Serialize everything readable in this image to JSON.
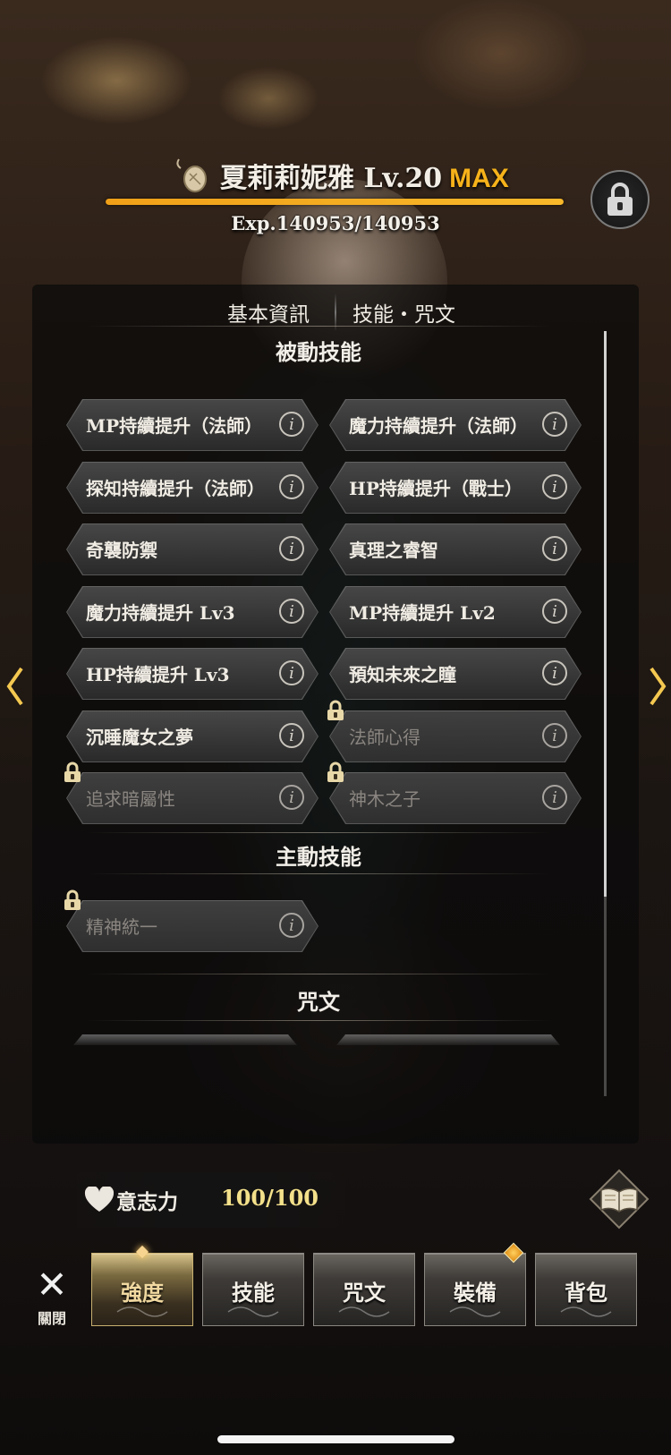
{
  "character": {
    "name": "夏莉莉妮雅",
    "level": "Lv.20",
    "max_label": "MAX",
    "exp": "Exp.140953/140953",
    "exp_progress": 1.0
  },
  "tabs": {
    "basic": "基本資訊",
    "skill": "技能・咒文",
    "active": "skill"
  },
  "sections": {
    "passive": "被動技能",
    "active": "主動技能",
    "spells": "咒文"
  },
  "passive_skills": [
    {
      "label": "MP持續提升（法師）",
      "locked": false
    },
    {
      "label": "魔力持續提升（法師）",
      "locked": false
    },
    {
      "label": "探知持續提升（法師）",
      "locked": false
    },
    {
      "label": "HP持續提升（戰士）",
      "locked": false
    },
    {
      "label": "奇襲防禦",
      "locked": false
    },
    {
      "label": "真理之睿智",
      "locked": false
    },
    {
      "label": "魔力持續提升 Lv3",
      "locked": false
    },
    {
      "label": "MP持續提升 Lv2",
      "locked": false
    },
    {
      "label": "HP持續提升 Lv3",
      "locked": false
    },
    {
      "label": "預知未來之瞳",
      "locked": false
    },
    {
      "label": "沉睡魔女之夢",
      "locked": false
    },
    {
      "label": "法師心得",
      "locked": true
    },
    {
      "label": "追求暗屬性",
      "locked": true
    },
    {
      "label": "神木之子",
      "locked": true
    }
  ],
  "active_skills": [
    {
      "label": "精神統一",
      "locked": true
    }
  ],
  "info_glyph": "i",
  "will": {
    "label": "意志力",
    "value": "100/100"
  },
  "bottom_nav": {
    "close_label": "關閉",
    "items": [
      {
        "label": "強度",
        "active": true,
        "badge": false
      },
      {
        "label": "技能",
        "active": false,
        "badge": false
      },
      {
        "label": "咒文",
        "active": false,
        "badge": false
      },
      {
        "label": "裝備",
        "active": false,
        "badge": true
      },
      {
        "label": "背包",
        "active": false,
        "badge": false
      }
    ]
  },
  "colors": {
    "accent_gold": "#f6b21a",
    "will_value": "#f3e08a"
  }
}
